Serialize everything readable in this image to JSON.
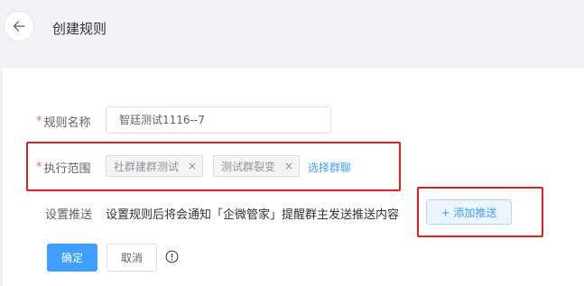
{
  "header": {
    "title": "创建规则",
    "back_icon": "arrow-left-icon"
  },
  "form": {
    "rule_name": {
      "label": "规则名称",
      "required_mark": "*",
      "value": "智廷测试1116--7"
    },
    "scope": {
      "label": "执行范围",
      "required_mark": "*",
      "tags": [
        {
          "label": "社群建群测试",
          "close": "×"
        },
        {
          "label": "测试群裂变",
          "close": "×"
        }
      ],
      "select_link": "选择群聊"
    },
    "push": {
      "label": "设置推送",
      "description": "设置规则后将会通知「企微管家」提醒群主发送推送内容",
      "add_button": "+ 添加推送"
    }
  },
  "actions": {
    "confirm": "确定",
    "cancel": "取消",
    "info_icon": "info-circle-icon"
  },
  "colors": {
    "accent": "#409eff",
    "required": "#f56c6c",
    "highlight_box": "#e02020"
  }
}
